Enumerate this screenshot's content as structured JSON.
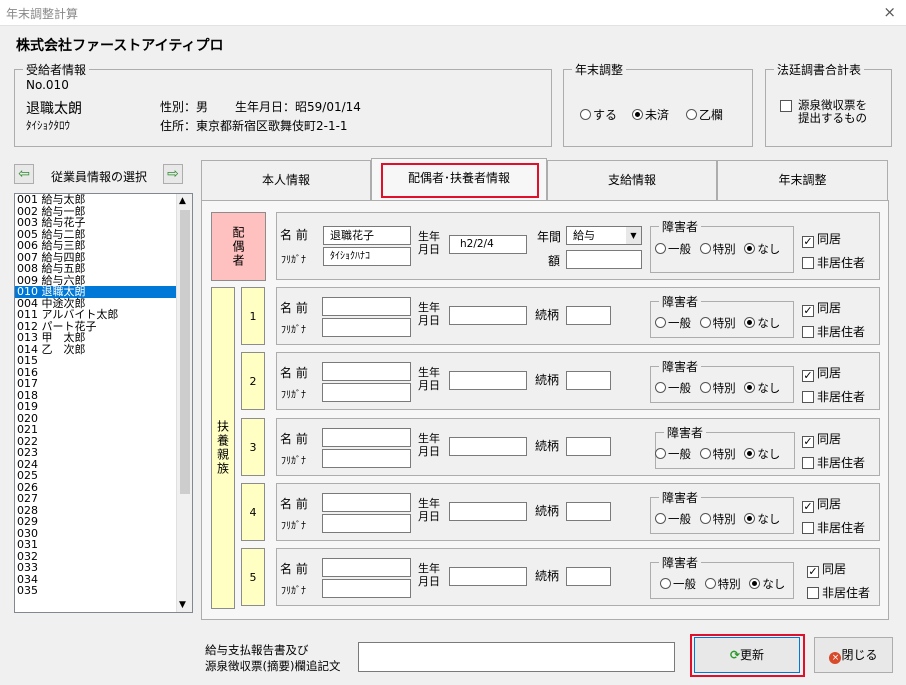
{
  "window": {
    "title": "年末調整計算",
    "close": "×"
  },
  "company": "株式会社ファーストアイティプロ",
  "recipient": {
    "legend": "受給者情報",
    "no": "No.010",
    "name": "退職太朗",
    "kana": "ﾀｲｼｮｸﾀﾛｳ",
    "gender": "性別：男",
    "birth": "生年月日：昭59/01/14",
    "address": "住所：東京都新宿区歌舞伎町2-1-1"
  },
  "year_end": {
    "legend": "年末調整",
    "options": [
      "する",
      "未済",
      "乙欄"
    ],
    "selected": 1
  },
  "statutory": {
    "legend": "法廷調書合計表",
    "checkbox_label": "源泉徴収票を提出するもの"
  },
  "employee_select": {
    "label": "従業員情報の選択",
    "prev": "⇦",
    "next": "⇨"
  },
  "employees": [
    "001 給与太郎",
    "002 給与一郎",
    "003 給与花子",
    "005 給与二郎",
    "006 給与三郎",
    "007 給与四郎",
    "008 給与五郎",
    "009 給与六郎",
    "010 退職太朗",
    "004 中途次郎",
    "011 アルバイト太郎",
    "012 パート花子",
    "013 甲　太郎",
    "014 乙　次郎",
    "015",
    "016",
    "017",
    "018",
    "019",
    "020",
    "021",
    "022",
    "023",
    "024",
    "025",
    "026",
    "027",
    "028",
    "029",
    "030",
    "031",
    "032",
    "033",
    "034",
    "035"
  ],
  "selected_employee_index": 8,
  "tabs": [
    "本人情報",
    "配偶者･扶養者情報",
    "支給情報",
    "年末調整"
  ],
  "active_tab": 1,
  "labels": {
    "name": "名 前",
    "furigana": "ﾌﾘｶﾞﾅ",
    "birth_top": "生年",
    "birth_bottom": "月日",
    "annual": "年間",
    "amount": "額",
    "relation": "続柄",
    "disability": "障害者",
    "dis_general": "一般",
    "dis_special": "特別",
    "dis_none": "なし",
    "cohabit": "同居",
    "nonresident": "非居住者"
  },
  "spouse": {
    "header": "配偶者",
    "name": "退職花子",
    "kana": "ﾀｲｼｮｸﾊﾅｺ",
    "birth": "h2/2/4",
    "income_type": "給与",
    "amount": ""
  },
  "dependents_header": "扶養親族",
  "dependents": [
    {
      "no": "1"
    },
    {
      "no": "2"
    },
    {
      "no": "3"
    },
    {
      "no": "4"
    },
    {
      "no": "5"
    }
  ],
  "remarks_label_1": "給与支払報告書及び",
  "remarks_label_2": "源泉徴収票(摘要)欄追記文",
  "remarks_value": "",
  "buttons": {
    "update": "更新",
    "close": "閉じる"
  }
}
